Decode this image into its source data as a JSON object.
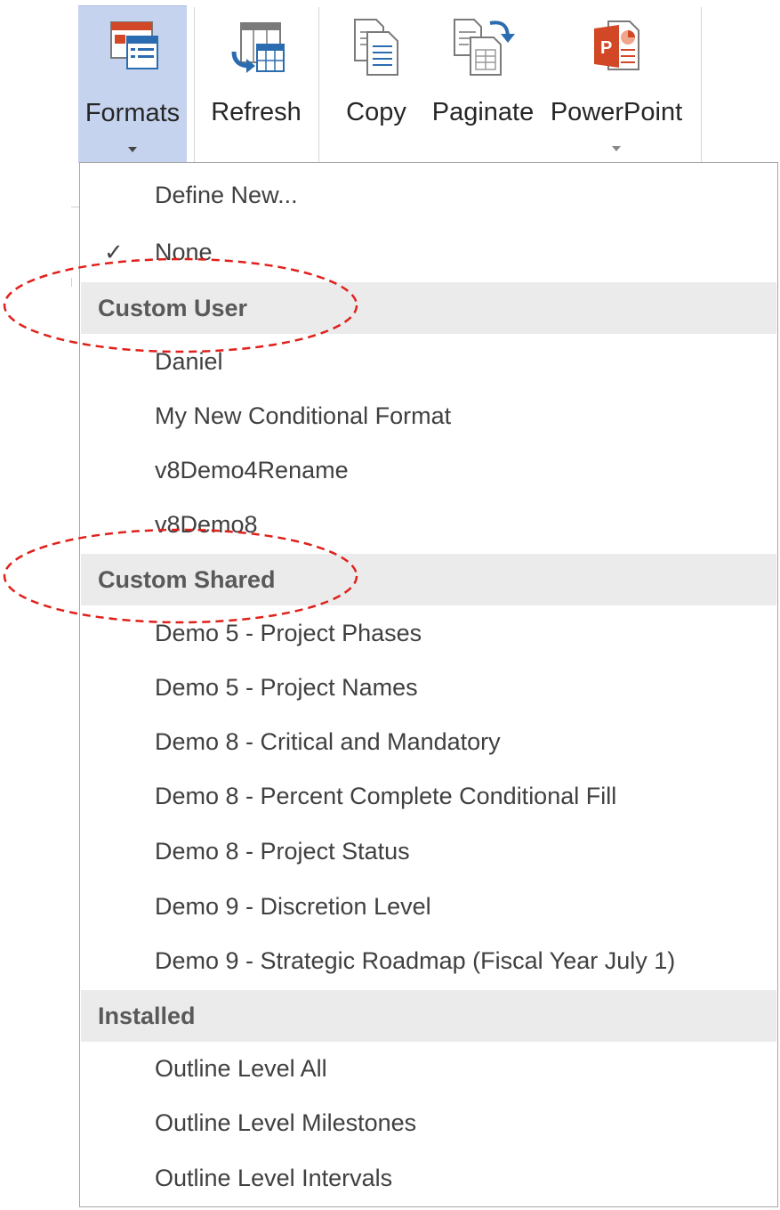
{
  "ribbon": {
    "formats": {
      "label": "Formats",
      "icon": "conditional-formats-icon"
    },
    "refresh": {
      "label": "Refresh",
      "icon": "refresh-table-icon"
    },
    "copy": {
      "label": "Copy",
      "icon": "copy-icon"
    },
    "paginate": {
      "label": "Paginate",
      "icon": "paginate-icon"
    },
    "powerpoint": {
      "label": "PowerPoint",
      "icon": "powerpoint-icon"
    }
  },
  "menu": {
    "define_new": "Define New...",
    "none": "None",
    "none_checked": true,
    "custom_user": {
      "header": "Custom User",
      "items": [
        "Daniel",
        "My New Conditional Format",
        "v8Demo4Rename",
        "v8Demo8"
      ]
    },
    "custom_shared": {
      "header": "Custom Shared",
      "items": [
        "Demo 5 - Project Phases",
        "Demo 5 - Project Names",
        "Demo 8 - Critical and Mandatory",
        "Demo 8 - Percent Complete Conditional Fill",
        "Demo 8 - Project Status",
        "Demo 9 - Discretion Level",
        "Demo 9 - Strategic Roadmap (Fiscal Year July 1)"
      ]
    },
    "installed": {
      "header": "Installed",
      "items": [
        "Outline Level All",
        "Outline Level Milestones",
        "Outline Level Intervals"
      ]
    }
  },
  "colors": {
    "selected_button": "#c5d3ee",
    "group_header_bg": "#ebebeb",
    "annotation": "#e0201b",
    "powerpoint_red": "#d24726",
    "accent_blue": "#2b6cb0"
  }
}
